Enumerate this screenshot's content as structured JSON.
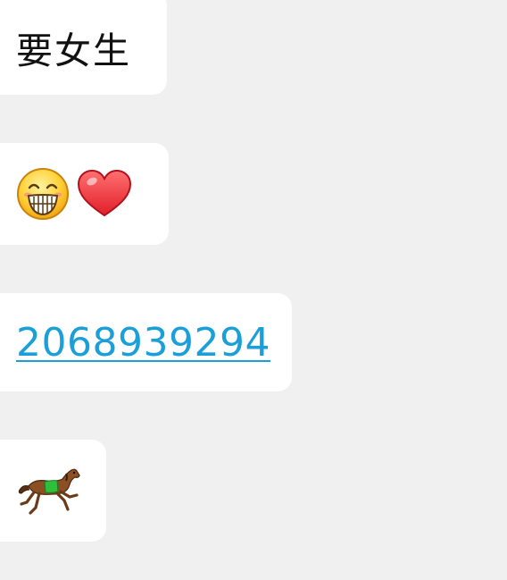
{
  "messages": [
    {
      "type": "text",
      "text": "要女生"
    },
    {
      "type": "emoji",
      "emojis": [
        "grinning-face",
        "red-heart"
      ]
    },
    {
      "type": "link",
      "text": "2068939294"
    },
    {
      "type": "emoji",
      "emojis": [
        "racing-horse"
      ]
    }
  ],
  "colors": {
    "background": "#f0f0f0",
    "bubble": "#ffffff",
    "text": "#111111",
    "link": "#1a9fd8"
  }
}
